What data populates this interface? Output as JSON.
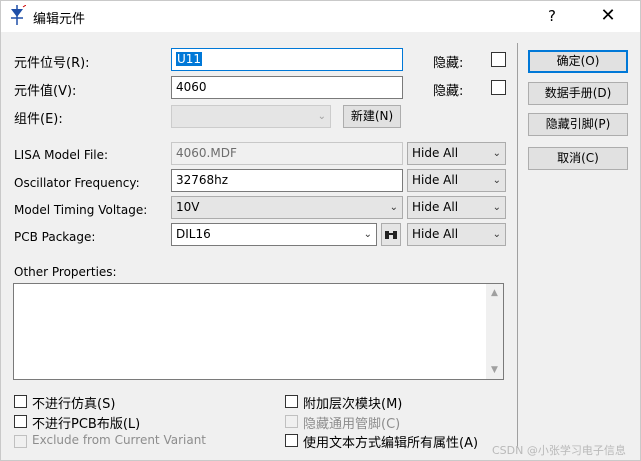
{
  "window": {
    "title": "编辑元件",
    "help_label": "?",
    "close_label": "✕"
  },
  "fields": {
    "ref_label": "元件位号(R):",
    "ref_value": "U11",
    "ref_hidden_label": "隐藏:",
    "value_label": "元件值(V):",
    "value_value": "4060",
    "value_hidden_label": "隐藏:",
    "group_label": "组件(E):",
    "group_new_button": "新建(N)",
    "lisa_label": "LISA Model File:",
    "lisa_value": "4060.MDF",
    "lisa_vis": "Hide All",
    "osc_label": "Oscillator Frequency:",
    "osc_value": "32768hz",
    "osc_vis": "Hide All",
    "timing_label": "Model Timing Voltage:",
    "timing_value": "10V",
    "timing_vis": "Hide All",
    "pcb_label": "PCB Package:",
    "pcb_value": "DIL16",
    "pcb_vis": "Hide All",
    "other_label": "Other Properties:"
  },
  "buttons": {
    "ok": "确定(O)",
    "datasheet": "数据手册(D)",
    "hide_pins": "隐藏引脚(P)",
    "cancel": "取消(C)"
  },
  "checks": {
    "exclude_sim": "不进行仿真(S)",
    "exclude_pcb": "不进行PCB布版(L)",
    "exclude_variant": "Exclude from Current Variant",
    "attach_hier": "附加层次模块(M)",
    "hide_common_pins": "隐藏通用管脚(C)",
    "edit_all_text": "使用文本方式编辑所有属性(A)"
  },
  "watermark": "CSDN @小张学习电子信息",
  "colors": {
    "accent": "#0078d7",
    "window_bg": "#f0f0f0"
  }
}
